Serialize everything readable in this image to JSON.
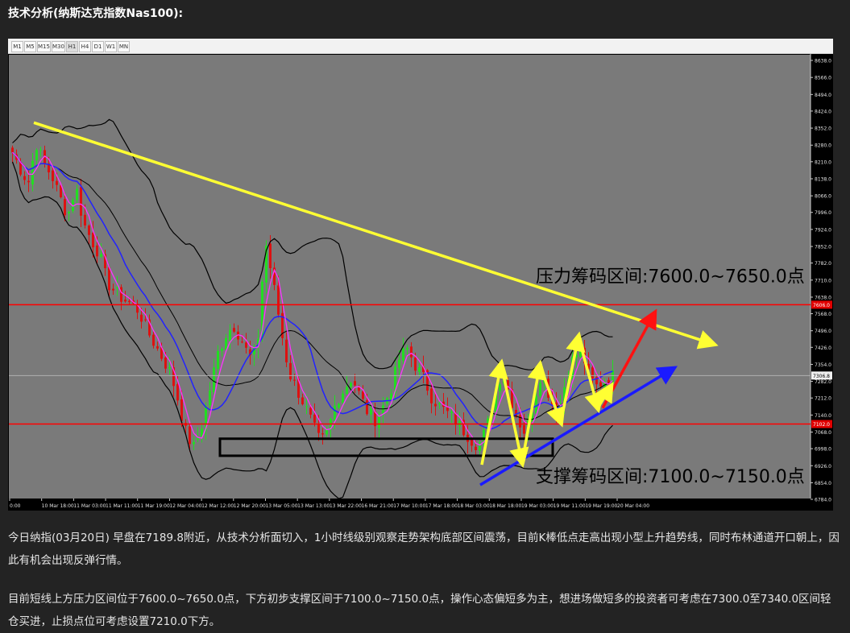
{
  "heading": "技术分析(纳斯达克指数Nas100):",
  "timeframes": [
    "M1",
    "M5",
    "M15",
    "M30",
    "H1",
    "H4",
    "D1",
    "W1",
    "MN"
  ],
  "active_timeframe": "H1",
  "colors": {
    "chart_bg": "#7a7a7a",
    "bull_candle": "#22dd22",
    "bear_candle": "#dd1111",
    "ma_fast": "#ff33ff",
    "ma_slow": "#2222ff",
    "bollinger": "#000000",
    "horizontal_level": "#ff0000",
    "trend_down": "#ffff33",
    "trend_up": "#1a1aff",
    "arrow_red": "#ff1111"
  },
  "chart_data": {
    "type": "candlestick",
    "price_axis_ticks": [
      "8638.0",
      "8566.0",
      "8494.0",
      "8424.0",
      "8352.0",
      "8280.0",
      "8210.0",
      "8138.0",
      "8066.0",
      "7996.0",
      "7924.0",
      "7852.0",
      "7782.0",
      "7710.0",
      "7638.0",
      "7568.0",
      "7496.0",
      "7426.0",
      "7354.0",
      "7282.0",
      "7212.0",
      "7140.0",
      "7068.0",
      "6998.0",
      "6926.0",
      "6854.0",
      "6784.0"
    ],
    "ylim": [
      6784.0,
      8638.0
    ],
    "time_axis_ticks": [
      "0:00",
      "10 Mar 18:00",
      "11 Mar 03:00",
      "11 Mar 11:00",
      "11 Mar 19:00",
      "12 Mar 04:00",
      "12 Mar 12:00",
      "12 Mar 20:00",
      "13 Mar 05:00",
      "13 Mar 13:00",
      "13 Mar 22:00",
      "16 Mar 21:00",
      "17 Mar 10:00",
      "17 Mar 18:00",
      "18 Mar 03:00",
      "18 Mar 18:00",
      "19 Mar 03:00",
      "19 Mar 11:00",
      "19 Mar 19:00",
      "20 Mar 04:00"
    ],
    "current_price_label": "7306.8",
    "resistance_line_label": "7606.0",
    "support_line_label": "7102.0",
    "resistance_level": 7606.0,
    "support_level": 7102.0,
    "annotation_resistance": "压力筹码区间:7600.0~7650.0点",
    "annotation_support": "支撑筹码区间:7100.0~7150.0点",
    "close_path": [
      8250,
      8180,
      8120,
      8290,
      8200,
      8150,
      8060,
      7980,
      8110,
      7950,
      7880,
      7820,
      7700,
      7660,
      7630,
      7610,
      7580,
      7500,
      7440,
      7380,
      7320,
      7200,
      7060,
      7000,
      7100,
      7250,
      7400,
      7480,
      7520,
      7460,
      7380,
      7420,
      7880,
      7700,
      7500,
      7320,
      7250,
      7180,
      7100,
      7020,
      7080,
      7200,
      7250,
      7300,
      7220,
      7150,
      7120,
      7180,
      7260,
      7380,
      7420,
      7350,
      7300,
      7220,
      7180,
      7150,
      7120,
      7080,
      7040,
      7010,
      7080,
      7210,
      7330,
      7220,
      7120,
      7060,
      7200,
      7330,
      7220,
      7140,
      7280,
      7380,
      7420,
      7300,
      7260,
      7290,
      7306.8
    ]
  },
  "paragraph1": "今日纳指(03月20日) 早盘在7189.8附近，从技术分析面切入，1小时线级别观察走势架构底部区间震荡，目前K棒低点走高出现小型上升趋势线，同时布林通道开口朝上，因此有机会出现反弹行情。",
  "paragraph2": "目前短线上方压力区间位于7600.0~7650.0点，下方初步支撑区间于7100.0~7150.0点，操作心态偏短多为主，想进场做短多的投资者可考虑在7300.0至7340.0区间轻仓买进，止损点位可考虑设置7210.0下方。"
}
